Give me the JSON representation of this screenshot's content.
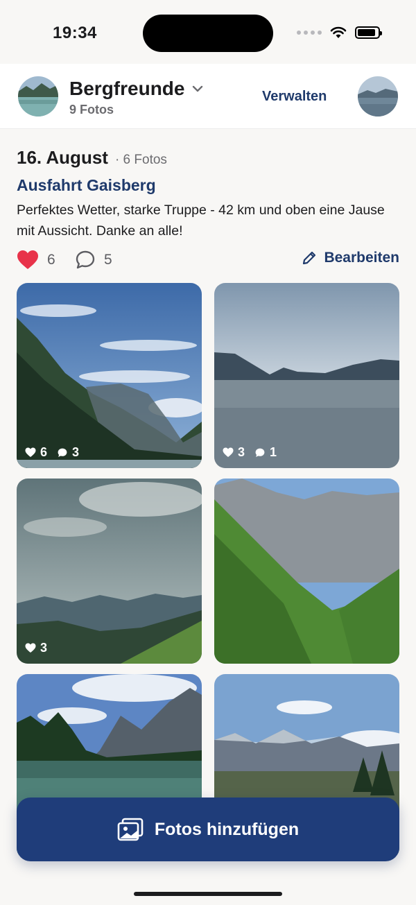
{
  "status": {
    "time": "19:34",
    "battery_level": 0.9
  },
  "header": {
    "group_name": "Bergfreunde",
    "photo_count": "9 Fotos",
    "manage_label": "Verwalten"
  },
  "album": {
    "date": "16. August",
    "date_count": "· 6 Fotos",
    "title": "Ausfahrt Gaisberg",
    "description": "Perfektes Wetter, starke Truppe - 42 km und oben eine Jause mit Aussicht. Danke an alle!",
    "likes": "6",
    "comments": "5",
    "edit_label": "Bearbeiten"
  },
  "photos": [
    {
      "likes": "6",
      "comments": "3"
    },
    {
      "likes": "3",
      "comments": "1"
    },
    {
      "likes": "3",
      "comments": ""
    },
    {
      "likes": "",
      "comments": ""
    },
    {
      "likes": "",
      "comments": ""
    },
    {
      "likes": "",
      "comments": ""
    }
  ],
  "fab": {
    "label": "Fotos hinzufügen"
  },
  "colors": {
    "accent": "#1f3a6b",
    "button": "#1f3d7a",
    "heart": "#e8334a"
  },
  "icons": [
    "wifi-icon",
    "battery-icon",
    "chevron-down-icon",
    "heart-icon",
    "comment-icon",
    "pencil-icon",
    "add-photo-icon"
  ]
}
